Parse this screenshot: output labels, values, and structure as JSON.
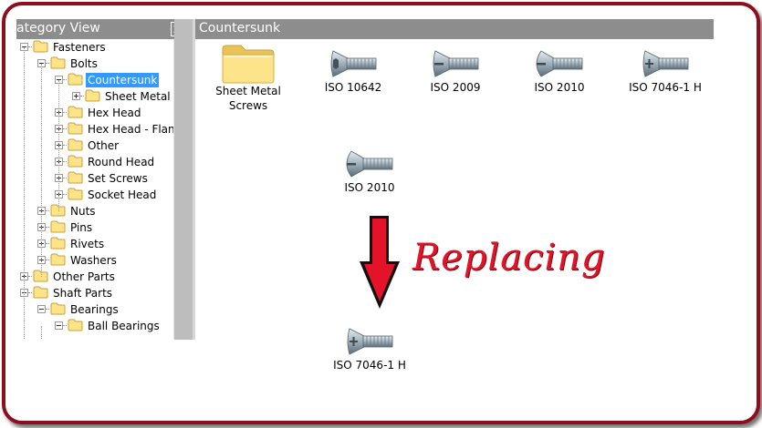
{
  "category_view": {
    "title": "ategory View",
    "tree": [
      {
        "label": "Fasteners",
        "level": 0,
        "expanded": true
      },
      {
        "label": "Bolts",
        "level": 1,
        "expanded": true
      },
      {
        "label": "Countersunk",
        "level": 2,
        "expanded": true,
        "selected": true
      },
      {
        "label": "Sheet Metal S",
        "level": 3,
        "expanded": false
      },
      {
        "label": "Hex Head",
        "level": 2,
        "expanded": false
      },
      {
        "label": "Hex Head - Flang",
        "level": 2,
        "expanded": false
      },
      {
        "label": "Other",
        "level": 2,
        "expanded": false
      },
      {
        "label": "Round Head",
        "level": 2,
        "expanded": false
      },
      {
        "label": "Set Screws",
        "level": 2,
        "expanded": false
      },
      {
        "label": "Socket Head",
        "level": 2,
        "expanded": false
      },
      {
        "label": "Nuts",
        "level": 1,
        "expanded": false
      },
      {
        "label": "Pins",
        "level": 1,
        "expanded": false
      },
      {
        "label": "Rivets",
        "level": 1,
        "expanded": false
      },
      {
        "label": "Washers",
        "level": 1,
        "expanded": false
      },
      {
        "label": "Other Parts",
        "level": 0,
        "expanded": false
      },
      {
        "label": "Shaft Parts",
        "level": 0,
        "expanded": true
      },
      {
        "label": "Bearings",
        "level": 1,
        "expanded": true
      },
      {
        "label": "Ball Bearings",
        "level": 2,
        "expanded": true
      }
    ]
  },
  "content": {
    "title": "Countersunk",
    "items": [
      {
        "label": "Sheet Metal Screws",
        "icon": "folder-icon"
      },
      {
        "label": "ISO 10642",
        "icon": "socket-countersunk-screw-icon"
      },
      {
        "label": "ISO 2009",
        "icon": "slotted-countersunk-screw-icon"
      },
      {
        "label": "ISO 2010",
        "icon": "raised-countersunk-screw-icon"
      },
      {
        "label": "ISO 7046-1 H",
        "icon": "phillips-countersunk-screw-icon"
      }
    ],
    "replaced_item": {
      "label": "ISO 2010"
    },
    "replacement_item": {
      "label": "ISO 7046-1 H"
    }
  },
  "annotation": {
    "text": "Replacing",
    "color": "#e3142a"
  },
  "colors": {
    "frame": "#8b0f1c",
    "header": "#8d8d8d",
    "selection": "#3399ff",
    "folder": "#fde48a"
  }
}
